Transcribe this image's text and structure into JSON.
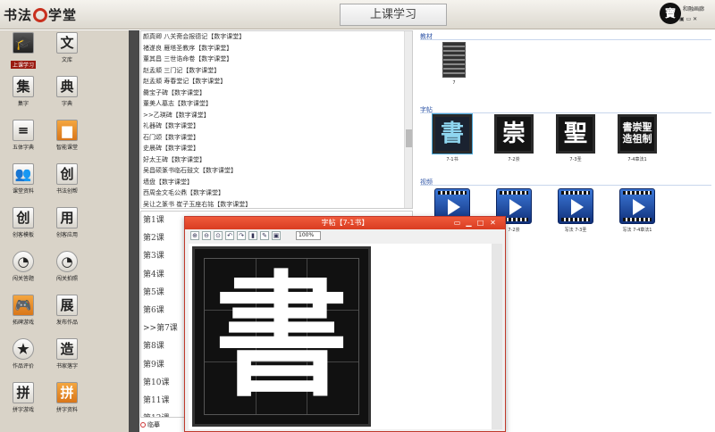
{
  "app": {
    "logo_text_left": "书法",
    "logo_text_right": "学堂",
    "page_title": "上课学习",
    "user": {
      "avatar_char": "寶",
      "name": "和融画廊"
    }
  },
  "sidebar": {
    "items": [
      {
        "label": "上课学习",
        "glyph": "🎓",
        "active": true
      },
      {
        "label": "文库",
        "glyph": "文"
      },
      {
        "label": "集字",
        "glyph": "集"
      },
      {
        "label": "字典",
        "glyph": "典"
      },
      {
        "label": "五体字典",
        "glyph": "≡"
      },
      {
        "label": "智能课堂",
        "glyph": "▆",
        "style": "orange"
      },
      {
        "label": "课堂资料",
        "glyph": "👥"
      },
      {
        "label": "书法创帮",
        "glyph": "创"
      },
      {
        "label": "创客模板",
        "glyph": "创"
      },
      {
        "label": "创客应用",
        "glyph": "用"
      },
      {
        "label": "闯关答题",
        "glyph": "◔",
        "style": "round"
      },
      {
        "label": "闯关拍照",
        "glyph": "◔",
        "style": "round"
      },
      {
        "label": "拓碑游戏",
        "glyph": "🎮",
        "style": "orange"
      },
      {
        "label": "发布作品",
        "glyph": "展"
      },
      {
        "label": "作品评价",
        "glyph": "★",
        "style": "round"
      },
      {
        "label": "书家落字",
        "glyph": "造"
      },
      {
        "label": "拼字游戏",
        "glyph": "拼"
      },
      {
        "label": "拼字资料",
        "glyph": "拼",
        "style": "orange"
      }
    ]
  },
  "text_list": [
    "颜真卿 八关斋会报德记【数字课堂】",
    "褚遂良 雁塔圣教序【数字课堂】",
    "董其昌 三世诰命卷【数字课堂】",
    "赵孟頫 三门记【数字课堂】",
    "赵孟頫 寿春堂记【数字课堂】",
    "爨宝子碑【数字课堂】",
    "董美人墓志【数字课堂】",
    ">>乙瑛碑【数字课堂】",
    "礼器碑【数字课堂】",
    "石门颂【数字课堂】",
    "史晨碑【数字课堂】",
    "好太王碑【数字课堂】",
    "吴昌硕篆书临石鼓文【数字课堂】",
    "墙盘【数字课堂】",
    "西周金文毛公鼎【数字课堂】",
    "吴让之篆书 崔子玉座右铭【数字课堂】"
  ],
  "lessons": [
    "第1课",
    "第2课",
    "第3课",
    "第4课",
    "第5课",
    "第6课",
    ">>第7课",
    "第8课",
    "第9课",
    "第10课",
    "第11课",
    "第12课"
  ],
  "lesson_footer": "临摹",
  "content": {
    "textbook": {
      "title": "教材",
      "items": [
        {
          "label": "7"
        }
      ]
    },
    "tie": {
      "title": "字帖",
      "items": [
        {
          "char": "書",
          "label": "7-1书",
          "style": "blue"
        },
        {
          "char": "崇",
          "label": "7-2崇"
        },
        {
          "char": "聖",
          "label": "7-3圣"
        },
        {
          "char": "書崇聖 造祖制",
          "label": "7-4章法1",
          "multi": true
        }
      ]
    },
    "video": {
      "title": "视频",
      "items": [
        {
          "label": ""
        },
        {
          "label": "7-2崇"
        },
        {
          "label": "写法 7-3圣"
        },
        {
          "label": "写法 7-4章法1"
        }
      ]
    }
  },
  "popup": {
    "title": "字帖【7-1书】",
    "zoom": "100%",
    "char": "書",
    "tools": [
      "⊕",
      "⊖",
      "⊙",
      "↶",
      "↷",
      "▮",
      "✎",
      "▣"
    ]
  }
}
